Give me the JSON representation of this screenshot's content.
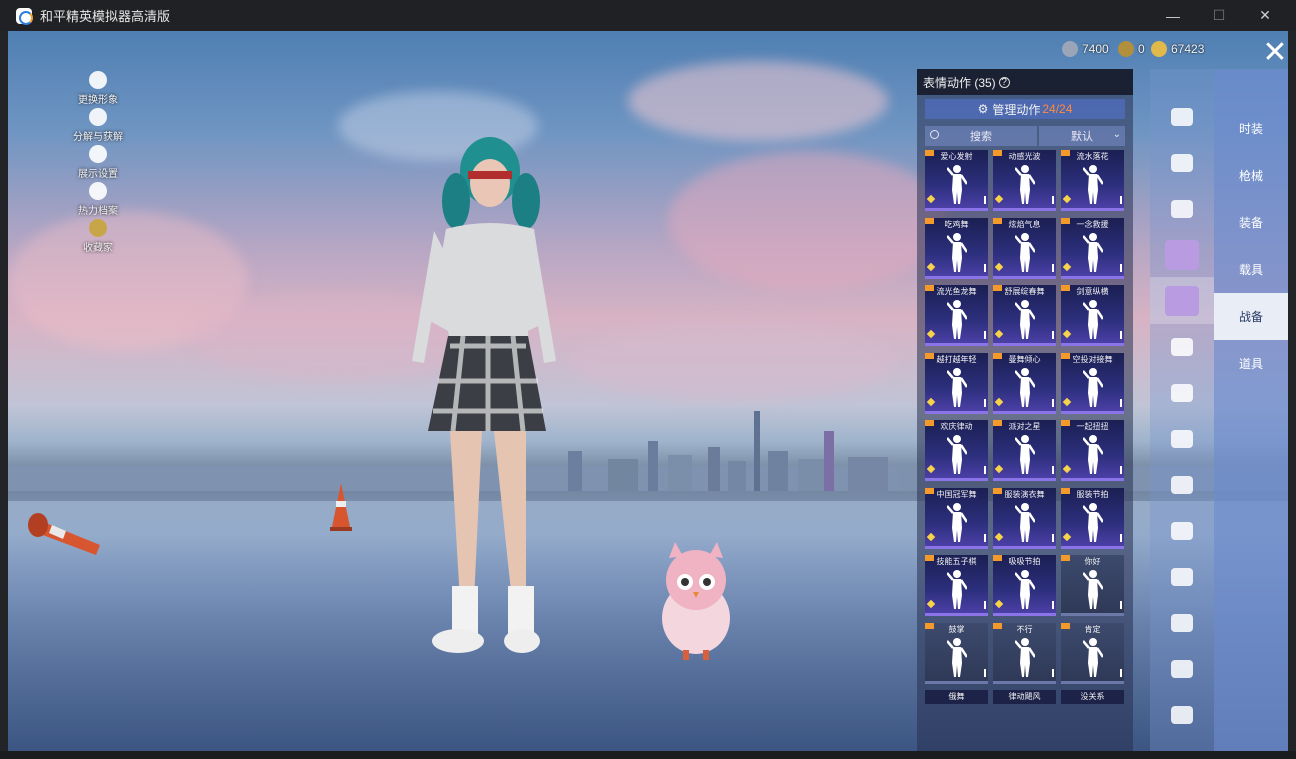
{
  "window": {
    "title": "和平精英模拟器高清版"
  },
  "currency": [
    {
      "icon": "silver-coin-icon",
      "value": "7400"
    },
    {
      "icon": "gold-badge-icon",
      "value": "0"
    },
    {
      "icon": "gold-coin-icon",
      "value": "67423"
    }
  ],
  "side_menu": [
    {
      "label": "更换形象",
      "icon": "avatar-icon"
    },
    {
      "label": "分解与获解",
      "icon": "puzzle-icon"
    },
    {
      "label": "展示设置",
      "icon": "eye-icon"
    },
    {
      "label": "热力档案",
      "icon": "flame-icon"
    },
    {
      "label": "收藏家",
      "icon": "collector-badge-icon"
    }
  ],
  "panel": {
    "title": "表情动作 (35)",
    "manage_label": "管理动作",
    "manage_count": "24/24",
    "search_placeholder": "搜索",
    "sort_label": "默认"
  },
  "emotes": [
    {
      "label": "爱心发射",
      "style": "purple"
    },
    {
      "label": "动感光波",
      "style": "purple"
    },
    {
      "label": "流水落花",
      "style": "purple"
    },
    {
      "label": "吃鸡舞",
      "style": "purple"
    },
    {
      "label": "炫焰气息",
      "style": "purple"
    },
    {
      "label": "一念救援",
      "style": "purple"
    },
    {
      "label": "流光鱼龙舞",
      "style": "purple"
    },
    {
      "label": "舒展绽春舞",
      "style": "purple"
    },
    {
      "label": "剑意纵横",
      "style": "purple"
    },
    {
      "label": "越打越年轻",
      "style": "purple"
    },
    {
      "label": "曼舞倾心",
      "style": "purple"
    },
    {
      "label": "空投对接舞",
      "style": "purple"
    },
    {
      "label": "欢庆律动",
      "style": "purple"
    },
    {
      "label": "派对之星",
      "style": "purple"
    },
    {
      "label": "一起扭扭",
      "style": "purple"
    },
    {
      "label": "中国冠军舞",
      "style": "purple"
    },
    {
      "label": "服装演衣舞",
      "style": "purple"
    },
    {
      "label": "服装节拍",
      "style": "purple"
    },
    {
      "label": "技能五子棋",
      "style": "purple"
    },
    {
      "label": "吸吸节拍",
      "style": "purple"
    },
    {
      "label": "你好",
      "style": "grey"
    },
    {
      "label": "鼓掌",
      "style": "grey"
    },
    {
      "label": "不行",
      "style": "grey"
    },
    {
      "label": "肯定",
      "style": "grey"
    },
    {
      "label": "俄舞",
      "style": "plain"
    },
    {
      "label": "律动飓风",
      "style": "plain"
    },
    {
      "label": "没关系",
      "style": "plain"
    }
  ],
  "icon_tabs": [
    "helmet-icon",
    "boat-icon",
    "drone-icon",
    "pet-icon",
    "pet-selected-icon",
    "plane-icon",
    "bag-icon",
    "speaker-icon",
    "sticker-icon",
    "photo-icon",
    "spray-icon",
    "hand-icon",
    "wand-icon",
    "parachute-icon"
  ],
  "categories": [
    {
      "label": "时装"
    },
    {
      "label": "枪械"
    },
    {
      "label": "装备"
    },
    {
      "label": "载具"
    },
    {
      "label": "战备"
    },
    {
      "label": "道具"
    }
  ],
  "colors": {
    "accent_orange": "#ff8a3d",
    "card_border": "#8a74e8"
  }
}
